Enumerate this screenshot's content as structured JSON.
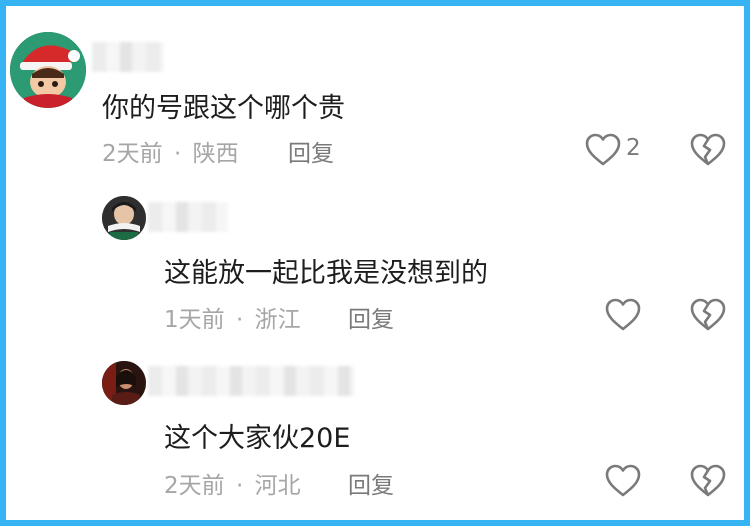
{
  "comments": [
    {
      "text": "你的号跟这个哪个贵",
      "time": "2天前",
      "sep": "·",
      "location": "陕西",
      "reply": "回复",
      "likes": "2"
    },
    {
      "text": "这能放一起比我是没想到的",
      "time": "1天前",
      "sep": "·",
      "location": "浙江",
      "reply": "回复"
    },
    {
      "text": "这个大家伙20E",
      "time": "2天前",
      "sep": "·",
      "location": "河北",
      "reply": "回复"
    }
  ],
  "icons": {
    "like": "heart-outline-icon",
    "dislike": "broken-heart-icon"
  },
  "colors": {
    "border": "#35b3f2",
    "text": "#1d1d1d",
    "meta": "#a6a6a6",
    "reply": "#7a7a7a"
  }
}
